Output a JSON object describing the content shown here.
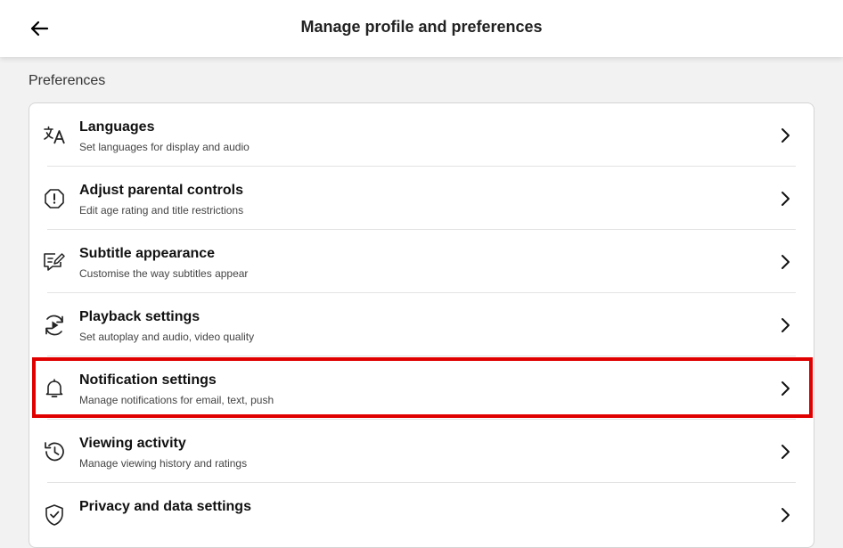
{
  "header": {
    "back_label": "Back",
    "title": "Manage profile and preferences"
  },
  "section": {
    "heading": "Preferences"
  },
  "items": [
    {
      "icon": "languages-icon",
      "label": "Languages",
      "description": "Set languages for display and audio"
    },
    {
      "icon": "parental-controls-icon",
      "label": "Adjust parental controls",
      "description": "Edit age rating and title restrictions"
    },
    {
      "icon": "subtitle-appearance-icon",
      "label": "Subtitle appearance",
      "description": "Customise the way subtitles appear"
    },
    {
      "icon": "playback-icon",
      "label": "Playback settings",
      "description": "Set autoplay and audio, video quality"
    },
    {
      "icon": "bell-icon",
      "label": "Notification settings",
      "description": "Manage notifications for email, text, push"
    },
    {
      "icon": "history-icon",
      "label": "Viewing activity",
      "description": "Manage viewing history and ratings"
    },
    {
      "icon": "shield-check-icon",
      "label": "Privacy and data settings",
      "description": ""
    }
  ],
  "highlight_color": "#e00000"
}
